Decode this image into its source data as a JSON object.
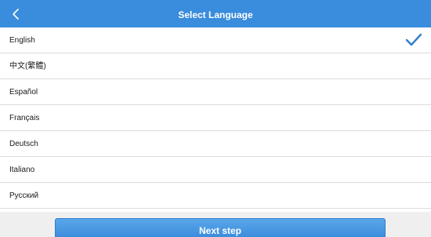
{
  "header": {
    "title": "Select Language",
    "back_icon": "chevron-left-icon"
  },
  "languages": [
    {
      "label": "English",
      "selected": true
    },
    {
      "label": "中文(繁體)",
      "selected": false
    },
    {
      "label": "Español",
      "selected": false
    },
    {
      "label": "Français",
      "selected": false
    },
    {
      "label": "Deutsch",
      "selected": false
    },
    {
      "label": "Italiano",
      "selected": false
    },
    {
      "label": "Русский",
      "selected": false
    }
  ],
  "selected_icon": "checkmark-icon",
  "footer": {
    "next_label": "Next step"
  },
  "colors": {
    "accent": "#3a8cdc",
    "check": "#2f7ecb",
    "footer_bg": "#efefef",
    "divider": "#dcdcdc"
  }
}
